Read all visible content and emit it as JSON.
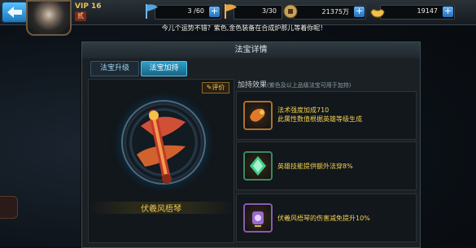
{
  "header": {
    "vip_label": "VIP 16",
    "rank_char": "贰",
    "resources": [
      {
        "icon": "stamina-flag-icon",
        "value": "3 /60",
        "color": "#4fa3e0"
      },
      {
        "icon": "energy-flag-icon",
        "value": "3/30",
        "color": "#e8a33a"
      },
      {
        "icon": "coin-icon",
        "value": "21375万",
        "color": "#c9a25a"
      },
      {
        "icon": "gold-ingot-icon",
        "value": "19147",
        "color": "#f0c24a"
      }
    ],
    "plus_label": "+"
  },
  "notice": "今儿个运势不错？紫色,金色装备在合成炉那儿等着你呢！",
  "panel": {
    "title": "法宝详情",
    "tabs": [
      {
        "label": "法宝升级",
        "active": false
      },
      {
        "label": "法宝加持",
        "active": true
      }
    ],
    "eval_label": "评价",
    "item_name": "伏羲风梧琴",
    "bonus_header": "加持效果",
    "bonus_sub": "(紫色及以上品级法宝可用于加持)",
    "effects": [
      {
        "icon": "fire-dragon-icon",
        "line1": "法术强度加成710",
        "line2": "此属性数值根据英雄等级生成"
      },
      {
        "icon": "green-crystal-icon",
        "line1": "英雄技能提供额外法穿8%",
        "line2": ""
      },
      {
        "icon": "purple-lamp-icon",
        "line1": "伏羲风梧琴的伤害减免提升10%",
        "line2": ""
      }
    ]
  },
  "colors": {
    "accent": "#2fa0c8",
    "gold_text": "#f0c452"
  }
}
